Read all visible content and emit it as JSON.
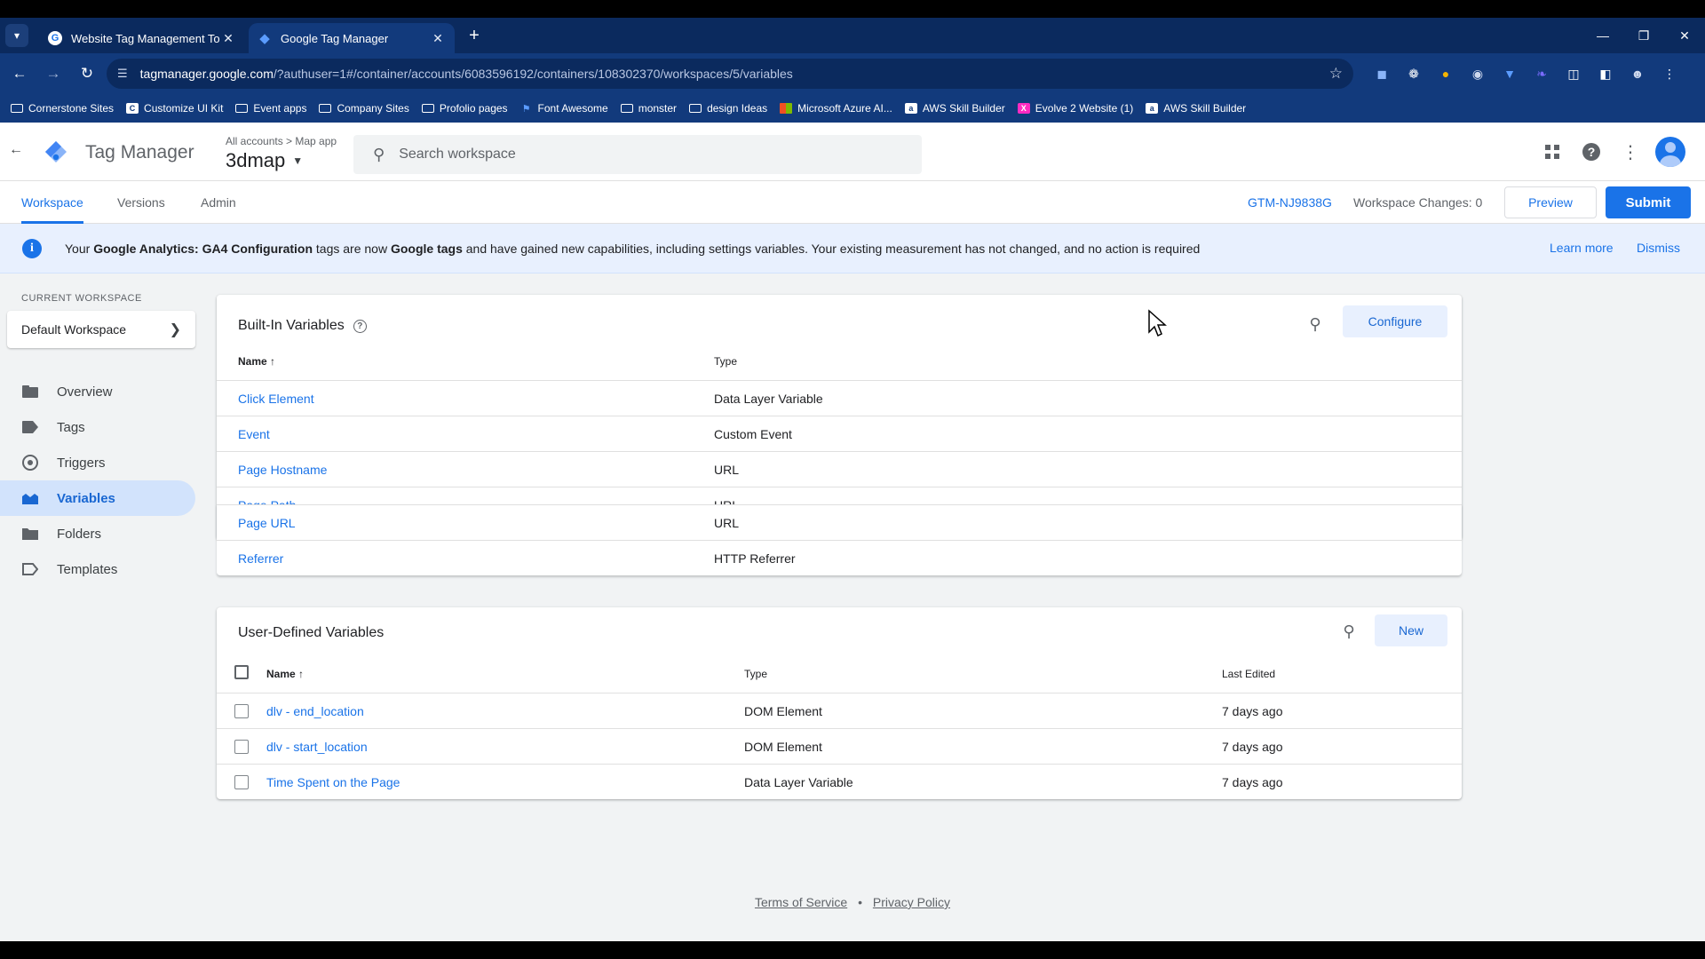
{
  "browser": {
    "tabs": [
      {
        "title": "Website Tag Management Tool",
        "active": false
      },
      {
        "title": "Google Tag Manager",
        "active": true
      }
    ],
    "url_host": "tagmanager.google.com",
    "url_path": "/?authuser=1#/container/accounts/6083596192/containers/108302370/workspaces/5/variables",
    "bookmarks": [
      {
        "label": "Cornerstone Sites",
        "icon": "folder-icon"
      },
      {
        "label": "Customize UI Kit",
        "icon": "site-icon"
      },
      {
        "label": "Event apps",
        "icon": "folder-icon"
      },
      {
        "label": "Company Sites",
        "icon": "folder-icon"
      },
      {
        "label": "Profolio pages",
        "icon": "folder-icon"
      },
      {
        "label": "Font Awesome",
        "icon": "flag-icon"
      },
      {
        "label": "monster",
        "icon": "folder-icon"
      },
      {
        "label": "design Ideas",
        "icon": "folder-icon"
      },
      {
        "label": "Microsoft Azure AI...",
        "icon": "microsoft-icon"
      },
      {
        "label": "AWS Skill Builder",
        "icon": "aws-icon"
      },
      {
        "label": "Evolve 2 Website (1)",
        "icon": "xd-icon"
      },
      {
        "label": "AWS Skill Builder",
        "icon": "aws-icon"
      }
    ]
  },
  "header": {
    "app_title": "Tag Manager",
    "breadcrumb": "All accounts > Map app",
    "container_name": "3dmap",
    "search_placeholder": "Search workspace"
  },
  "subnav": {
    "tabs": [
      "Workspace",
      "Versions",
      "Admin"
    ],
    "active_tab": "Workspace",
    "container_id": "GTM-NJ9838G",
    "workspace_changes": "Workspace Changes: 0",
    "preview_label": "Preview",
    "submit_label": "Submit"
  },
  "notice": {
    "t1": "Your ",
    "b1": "Google Analytics: GA4 Configuration",
    "t2": " tags are now ",
    "b2": "Google tags",
    "t3": " and have gained new capabilities, including settings variables. Your existing measurement has not changed, and no action is required",
    "learn_more": "Learn more",
    "dismiss": "Dismiss"
  },
  "sidebar": {
    "workspace_label": "CURRENT WORKSPACE",
    "workspace_name": "Default Workspace",
    "items": [
      {
        "label": "Overview",
        "icon": "overview-icon"
      },
      {
        "label": "Tags",
        "icon": "tag-icon"
      },
      {
        "label": "Triggers",
        "icon": "trigger-icon"
      },
      {
        "label": "Variables",
        "icon": "variables-icon",
        "active": true
      },
      {
        "label": "Folders",
        "icon": "folder-icon"
      },
      {
        "label": "Templates",
        "icon": "template-icon"
      }
    ]
  },
  "builtin": {
    "title": "Built-In Variables",
    "configure_label": "Configure",
    "col_name": "Name",
    "col_type": "Type",
    "rows": [
      {
        "name": "Click Element",
        "type": "Data Layer Variable"
      },
      {
        "name": "Event",
        "type": "Custom Event"
      },
      {
        "name": "Page Hostname",
        "type": "URL"
      },
      {
        "name": "Page Path",
        "type": "URL"
      },
      {
        "name": "Page URL",
        "type": "URL"
      },
      {
        "name": "Referrer",
        "type": "HTTP Referrer"
      }
    ]
  },
  "userdefined": {
    "title": "User-Defined Variables",
    "new_label": "New",
    "col_name": "Name",
    "col_type": "Type",
    "col_edited": "Last Edited",
    "rows": [
      {
        "name": "dlv - end_location",
        "type": "DOM Element",
        "edited": "7 days ago"
      },
      {
        "name": "dlv - start_location",
        "type": "DOM Element",
        "edited": "7 days ago"
      },
      {
        "name": "Time Spent on the Page",
        "type": "Data Layer Variable",
        "edited": "7 days ago"
      }
    ]
  },
  "footer": {
    "terms": "Terms of Service",
    "sep": "•",
    "privacy": "Privacy Policy"
  },
  "colors": {
    "accent": "#1a73e8",
    "chrome": "#123a7c",
    "page_bg": "#f1f3f4"
  }
}
